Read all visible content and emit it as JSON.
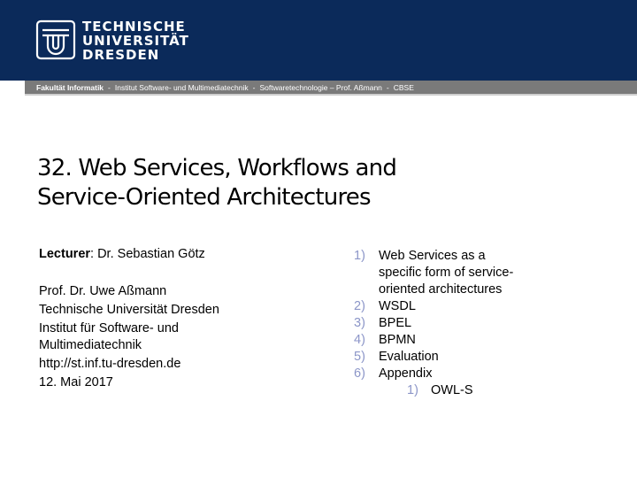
{
  "header": {
    "logo_lines": [
      "TECHNISCHE",
      "UNIVERSITÄT",
      "DRESDEN"
    ]
  },
  "infobar": {
    "faculty": "Fakultät Informatik",
    "separator": "-",
    "institute": "Institut Software- und Multimediatechnik",
    "chair": "Softwaretechnologie – Prof. Aßmann",
    "group": "CBSE"
  },
  "title": {
    "line1": "32. Web Services, Workflows and",
    "line2": "Service-Oriented Architectures"
  },
  "author_block": {
    "lecturer_label": "Lecturer",
    "lecturer_name": ": Dr. Sebastian Götz",
    "professor": "Prof. Dr. Uwe Aßmann",
    "university": "Technische Universität Dresden",
    "institute": "Institut für Software- und Multimediatechnik",
    "url": "http://st.inf.tu-dresden.de",
    "date": "12. Mai 2017"
  },
  "toc": {
    "items": [
      {
        "num": "1)",
        "label": "Web Services as a specific form of service-oriented architectures"
      },
      {
        "num": "2)",
        "label": "WSDL"
      },
      {
        "num": "3)",
        "label": "BPEL"
      },
      {
        "num": "4)",
        "label": "BPMN"
      },
      {
        "num": "5)",
        "label": "Evaluation"
      },
      {
        "num": "6)",
        "label": "Appendix"
      }
    ],
    "subitems": [
      {
        "num": "1)",
        "label": "OWL-S"
      }
    ]
  },
  "colors": {
    "header_bg": "#0b2a5a",
    "infobar_bg": "#7a7a7a",
    "list_number": "#8c96c8"
  }
}
